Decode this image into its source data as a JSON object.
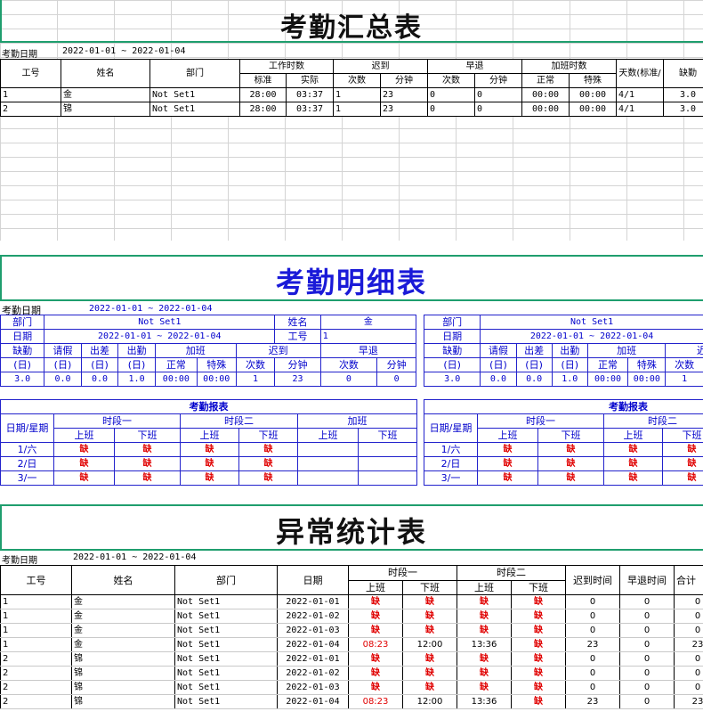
{
  "summary": {
    "title": "考勤汇总表",
    "date_label": "考勤日期",
    "date_range": "2022-01-01 ~ 2022-01-04",
    "headers": {
      "id": "工号",
      "name": "姓名",
      "dept": "部门",
      "work": "工作时数",
      "work_std": "标准",
      "work_act": "实际",
      "late": "迟到",
      "late_cnt": "次数",
      "late_min": "分钟",
      "early": "早退",
      "early_cnt": "次数",
      "early_min": "分钟",
      "ot": "加班时数",
      "ot_norm": "正常",
      "ot_spec": "特殊",
      "days": "天数(标准/",
      "absent": "缺勤"
    },
    "rows": [
      {
        "id": "1",
        "name": "金",
        "dept": "Not Set1",
        "std": "28:00",
        "act": "03:37",
        "late_cnt": "1",
        "late_min": "23",
        "early_cnt": "0",
        "early_min": "0",
        "ot_norm": "00:00",
        "ot_spec": "00:00",
        "days": "4/1",
        "absent": "3.0"
      },
      {
        "id": "2",
        "name": "锦",
        "dept": "Not Set1",
        "std": "28:00",
        "act": "03:37",
        "late_cnt": "1",
        "late_min": "23",
        "early_cnt": "0",
        "early_min": "0",
        "ot_norm": "00:00",
        "ot_spec": "00:00",
        "days": "4/1",
        "absent": "3.0"
      }
    ]
  },
  "detail": {
    "title": "考勤明细表",
    "date_label": "考勤日期",
    "date_range": "2022-01-01 ~ 2022-01-04",
    "labels": {
      "dept": "部门",
      "date": "日期",
      "name": "姓名",
      "id": "工号",
      "absent": "缺勤",
      "leave": "请假",
      "trip": "出差",
      "out": "出勤",
      "day_unit": "(日)",
      "ot": "加班",
      "ot_norm": "正常",
      "ot_spec": "特殊",
      "late": "迟到",
      "early": "早退",
      "cnt": "次数",
      "min": "分钟",
      "report": "考勤报表",
      "weekday": "日期/星期",
      "p1": "时段一",
      "p2": "时段二",
      "p_ot": "加班",
      "on": "上班",
      "off": "下班"
    },
    "cards": [
      {
        "dept": "Not Set1",
        "date": "2022-01-01 ~ 2022-01-04",
        "name": "金",
        "id": "1",
        "stats": {
          "absent": "3.0",
          "leave": "0.0",
          "trip": "0.0",
          "out": "1.0",
          "ot_norm": "00:00",
          "ot_spec": "00:00",
          "late_cnt": "1",
          "late_min": "23",
          "early_cnt": "0",
          "early_min": "0"
        },
        "days": [
          {
            "day": "1/六",
            "p1_on": "缺",
            "p1_off": "缺",
            "p2_on": "缺",
            "p2_off": "缺"
          },
          {
            "day": "2/日",
            "p1_on": "缺",
            "p1_off": "缺",
            "p2_on": "缺",
            "p2_off": "缺"
          },
          {
            "day": "3/一",
            "p1_on": "缺",
            "p1_off": "缺",
            "p2_on": "缺",
            "p2_off": "缺"
          }
        ]
      },
      {
        "dept": "Not Set1",
        "date": "2022-01-01 ~ 2022-01-04",
        "name": "",
        "id": "",
        "stats": {
          "absent": "3.0",
          "leave": "0.0",
          "trip": "0.0",
          "out": "1.0",
          "ot_norm": "00:00",
          "ot_spec": "00:00",
          "late_cnt": "1"
        },
        "days": [
          {
            "day": "1/六",
            "p1_on": "缺",
            "p1_off": "缺",
            "p2_on": "缺",
            "p2_off": "缺"
          },
          {
            "day": "2/日",
            "p1_on": "缺",
            "p1_off": "缺",
            "p2_on": "缺",
            "p2_off": "缺"
          },
          {
            "day": "3/一",
            "p1_on": "缺",
            "p1_off": "缺",
            "p2_on": "缺",
            "p2_off": "缺"
          }
        ]
      }
    ]
  },
  "abnormal": {
    "title": "异常统计表",
    "date_label": "考勤日期",
    "date_range": "2022-01-01 ~ 2022-01-04",
    "headers": {
      "id": "工号",
      "name": "姓名",
      "dept": "部门",
      "date": "日期",
      "p1": "时段一",
      "p2": "时段二",
      "on": "上班",
      "off": "下班",
      "late": "迟到时间",
      "early": "早退时间",
      "total": "合计"
    },
    "rows": [
      {
        "id": "1",
        "name": "金",
        "dept": "Not Set1",
        "date": "2022-01-01",
        "p1_on": "缺",
        "p1_off": "缺",
        "p2_on": "缺",
        "p2_off": "缺",
        "late": "0",
        "early": "0",
        "total": "0"
      },
      {
        "id": "1",
        "name": "金",
        "dept": "Not Set1",
        "date": "2022-01-02",
        "p1_on": "缺",
        "p1_off": "缺",
        "p2_on": "缺",
        "p2_off": "缺",
        "late": "0",
        "early": "0",
        "total": "0"
      },
      {
        "id": "1",
        "name": "金",
        "dept": "Not Set1",
        "date": "2022-01-03",
        "p1_on": "缺",
        "p1_off": "缺",
        "p2_on": "缺",
        "p2_off": "缺",
        "late": "0",
        "early": "0",
        "total": "0"
      },
      {
        "id": "1",
        "name": "金",
        "dept": "Not Set1",
        "date": "2022-01-04",
        "p1_on": "08:23",
        "p1_off": "12:00",
        "p2_on": "13:36",
        "p2_off": "缺",
        "late": "23",
        "early": "0",
        "total": "23"
      },
      {
        "id": "2",
        "name": "锦",
        "dept": "Not Set1",
        "date": "2022-01-01",
        "p1_on": "缺",
        "p1_off": "缺",
        "p2_on": "缺",
        "p2_off": "缺",
        "late": "0",
        "early": "0",
        "total": "0"
      },
      {
        "id": "2",
        "name": "锦",
        "dept": "Not Set1",
        "date": "2022-01-02",
        "p1_on": "缺",
        "p1_off": "缺",
        "p2_on": "缺",
        "p2_off": "缺",
        "late": "0",
        "early": "0",
        "total": "0"
      },
      {
        "id": "2",
        "name": "锦",
        "dept": "Not Set1",
        "date": "2022-01-03",
        "p1_on": "缺",
        "p1_off": "缺",
        "p2_on": "缺",
        "p2_off": "缺",
        "late": "0",
        "early": "0",
        "total": "0"
      },
      {
        "id": "2",
        "name": "锦",
        "dept": "Not Set1",
        "date": "2022-01-04",
        "p1_on": "08:23",
        "p1_off": "12:00",
        "p2_on": "13:36",
        "p2_off": "缺",
        "late": "23",
        "early": "0",
        "total": "23"
      }
    ]
  }
}
